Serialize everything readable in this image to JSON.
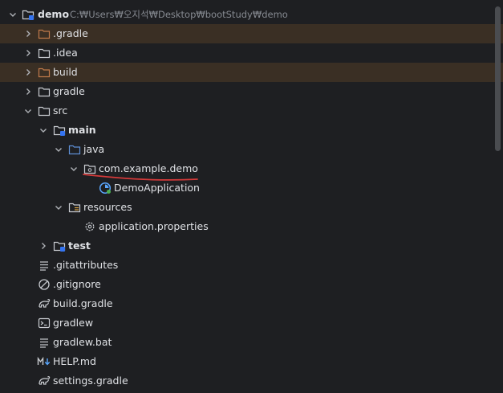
{
  "project": {
    "name": "demo",
    "path": "C:₩Users₩오지석₩Desktop₩bootStudy₩demo"
  },
  "items": [
    {
      "label": ".gradle"
    },
    {
      "label": ".idea"
    },
    {
      "label": "build"
    },
    {
      "label": "gradle"
    },
    {
      "label": "src"
    },
    {
      "label": "main"
    },
    {
      "label": "java"
    },
    {
      "label": "com.example.demo"
    },
    {
      "label": "DemoApplication"
    },
    {
      "label": "resources"
    },
    {
      "label": "application.properties"
    },
    {
      "label": "test"
    },
    {
      "label": ".gitattributes"
    },
    {
      "label": ".gitignore"
    },
    {
      "label": "build.gradle"
    },
    {
      "label": "gradlew"
    },
    {
      "label": "gradlew.bat"
    },
    {
      "label": "HELP.md"
    },
    {
      "label": "settings.gradle"
    }
  ],
  "colors": {
    "background": "#1e1f22",
    "excluded_row": "#3a2f24",
    "text": "#dfe1e5",
    "muted_path": "#868a91",
    "folder_excluded": "#c07a4a",
    "folder_source": "#5e8fd6",
    "spring_accent": "#5aa7ff",
    "underline": "#d43a3a"
  },
  "icons": {
    "module": "module-folder-icon",
    "folder": "folder-icon",
    "source": "source-folder-icon",
    "package": "package-icon",
    "spring_class": "spring-boot-class-icon",
    "resources": "resources-folder-icon",
    "properties": "settings-gear-icon",
    "text": "text-file-icon",
    "ignore": "ignore-file-icon",
    "gradle": "gradle-elephant-icon",
    "terminal": "shell-script-icon",
    "markdown": "markdown-icon"
  }
}
